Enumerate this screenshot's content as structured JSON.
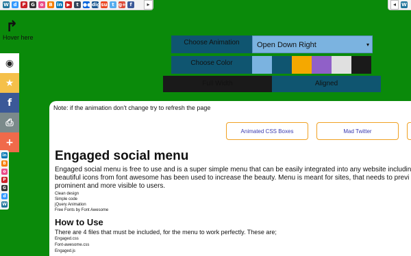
{
  "topbar": {
    "icons": [
      {
        "name": "wordpress-icon",
        "glyph": "W",
        "color": "#21759b"
      },
      {
        "name": "delicious-icon",
        "glyph": "d",
        "color": "#3399ff"
      },
      {
        "name": "pinterest-icon",
        "glyph": "P",
        "color": "#cb2027"
      },
      {
        "name": "github-icon",
        "glyph": "G",
        "color": "#333333"
      },
      {
        "name": "dribbble-icon",
        "glyph": "o",
        "color": "#ea4c89"
      },
      {
        "name": "blogger-icon",
        "glyph": "B",
        "color": "#f57d00"
      },
      {
        "name": "linkedin-icon",
        "glyph": "in",
        "color": "#0077b5"
      },
      {
        "name": "youtube-icon",
        "glyph": "▶",
        "color": "#cd201f"
      },
      {
        "name": "tumblr-icon",
        "glyph": "t",
        "color": "#35465c"
      },
      {
        "name": "flickr-icon",
        "glyph": "●●",
        "color": "#0063dc"
      },
      {
        "name": "digg-icon",
        "glyph": "digg",
        "color": "#1b5891"
      },
      {
        "name": "stumbleupon-icon",
        "glyph": "su",
        "color": "#eb4924"
      },
      {
        "name": "twitter-icon",
        "glyph": "t",
        "color": "#55acee"
      },
      {
        "name": "googleplus-icon",
        "glyph": "g+",
        "color": "#dd4b39"
      },
      {
        "name": "facebook-icon",
        "glyph": "f",
        "color": "#3b5998"
      }
    ],
    "toggle": "▸"
  },
  "topbar_right": {
    "toggle": "◂",
    "icon": {
      "name": "wordpress-icon",
      "glyph": "W",
      "color": "#21759b"
    }
  },
  "hover_hint": {
    "arrow": "↱",
    "text": "Hover here"
  },
  "controls": {
    "animation_label": "Choose Animation",
    "animation_value": "Open Down Right",
    "animation_caret": "▾",
    "color_label": "Choose Color",
    "swatches": [
      "#7bb3e0",
      "#0f5570",
      "#f5a800",
      "#9060c8",
      "#e0e0e0",
      "#1a1a1a"
    ],
    "full_width": "Full Width",
    "aligned": "Aligned"
  },
  "sidebar": [
    {
      "name": "owl-icon",
      "glyph": "◉",
      "bg": "#ffffff",
      "fg": "#222222"
    },
    {
      "name": "star-icon",
      "glyph": "★",
      "bg": "#f5c04a",
      "fg": "#ffffff"
    },
    {
      "name": "facebook-icon",
      "glyph": "f",
      "bg": "#3b5998",
      "fg": "#ffffff"
    },
    {
      "name": "print-icon",
      "glyph": "⎙",
      "bg": "#7b8a8b",
      "fg": "#ffffff"
    },
    {
      "name": "plus-icon",
      "glyph": "+",
      "bg": "#f06a4a",
      "fg": "#ffffff"
    }
  ],
  "mini_icons": [
    {
      "name": "linkedin-icon",
      "glyph": "in",
      "color": "#0077b5"
    },
    {
      "name": "blogger-icon",
      "glyph": "B",
      "color": "#f57d00"
    },
    {
      "name": "dribbble-icon",
      "glyph": "o",
      "color": "#ea4c89"
    },
    {
      "name": "pinterest-icon",
      "glyph": "P",
      "color": "#cb2027"
    },
    {
      "name": "github-icon",
      "glyph": "G",
      "color": "#333333"
    },
    {
      "name": "delicious-icon",
      "glyph": "d",
      "color": "#3399ff"
    },
    {
      "name": "wordpress-icon",
      "glyph": "W",
      "color": "#21759b"
    }
  ],
  "content": {
    "note": "Note: if the animation don't change try to refresh the page",
    "btn1": "Animated CSS Boxes",
    "btn2": "Mad Twitter",
    "title": "Engaged social menu",
    "paragraph": "Engaged social menu is free to use and is a super simple menu that can be easily integrated into any website including beautiful icons from font awesome has been used to increase the beauty. Menu is meant for sites, that needs to previ prominent and more visible to users.",
    "features": [
      "Clean design",
      "Simple code",
      "jQuery Animation",
      "Free Fonts by Font Awesome"
    ],
    "howto_title": "How to Use",
    "howto_text": "There are 4 files that must be included, for the menu to work perfectly. These are;",
    "files": [
      "Engaged.css",
      "Font-awesome.css",
      "Engaged.js"
    ]
  }
}
